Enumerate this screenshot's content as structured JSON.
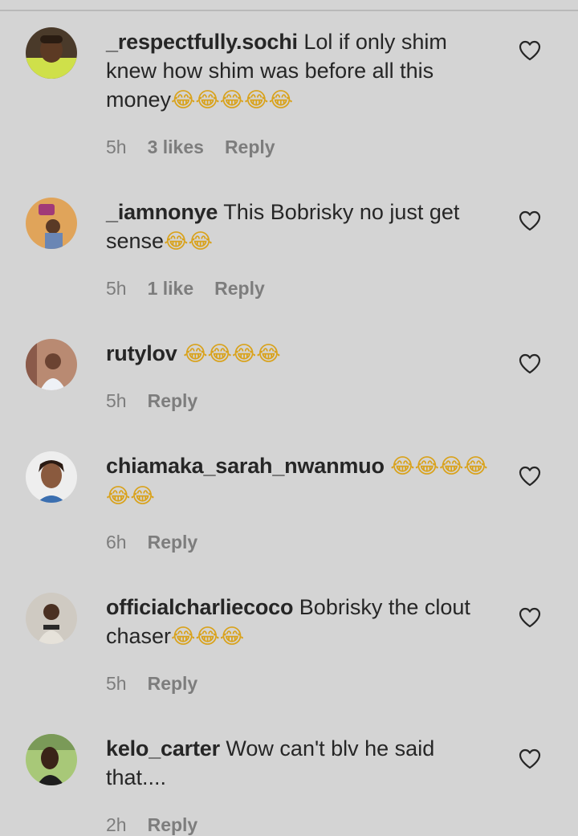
{
  "comments": [
    {
      "username": "_respectfully.sochi",
      "text": "Lol if only shim knew how shim was before all this money",
      "emoji": "😂😂😂😂😂",
      "time": "5h",
      "likes": "3 likes",
      "reply": "Reply"
    },
    {
      "username": "_iamnonye",
      "text": "This Bobrisky no just get sense",
      "emoji": "😂😂",
      "time": "5h",
      "likes": "1 like",
      "reply": "Reply"
    },
    {
      "username": "rutylov",
      "text": "",
      "emoji": "😂😂😂😂",
      "time": "5h",
      "reply": "Reply"
    },
    {
      "username": "chiamaka_sarah_nwanmuo",
      "text": "",
      "emoji": "😂😂😂😂😂😂",
      "time": "6h",
      "reply": "Reply"
    },
    {
      "username": "officialcharliecoco",
      "text": "Bobrisky the clout chaser",
      "emoji": "😂😂😂",
      "time": "5h",
      "reply": "Reply"
    },
    {
      "username": "kelo_carter",
      "text": "Wow can't blv he said that....",
      "emoji": "",
      "time": "2h",
      "reply": "Reply"
    }
  ],
  "icons": {
    "like": "heart-outline-icon"
  },
  "colors": {
    "background": "#d4d4d4",
    "text": "#262626",
    "meta": "#7d7d7d"
  }
}
